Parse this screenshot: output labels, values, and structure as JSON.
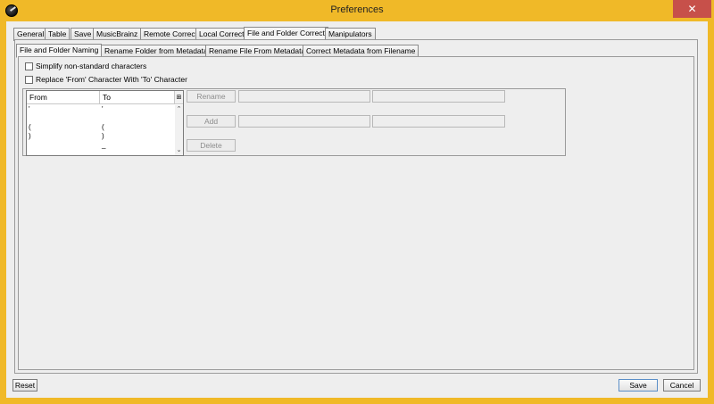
{
  "window": {
    "title": "Preferences",
    "close_glyph": "✕",
    "accent": "#f0b928",
    "close_color": "#c7504a"
  },
  "outer_tabs": [
    {
      "label": "General"
    },
    {
      "label": "Table"
    },
    {
      "label": "Save"
    },
    {
      "label": "MusicBrainz"
    },
    {
      "label": "Remote Correct"
    },
    {
      "label": "Local Correct"
    },
    {
      "label": "File and Folder Correct",
      "selected": true
    },
    {
      "label": "Manipulators"
    }
  ],
  "inner_tabs": [
    {
      "label": "File and Folder Naming",
      "selected": true
    },
    {
      "label": "Rename Folder from Metadata"
    },
    {
      "label": "Rename File From Metadata"
    },
    {
      "label": "Correct Metadata from Filename"
    }
  ],
  "options": {
    "simplify_label": "Simplify non-standard characters",
    "simplify_checked": false,
    "replace_label": "Replace 'From' Character With 'To' Character",
    "replace_checked": false
  },
  "char_table": {
    "headers": {
      "from": "From",
      "to": "To"
    },
    "column_menu_icon": "column-menu-icon",
    "rows": [
      {
        "from": "'",
        "to": "'"
      },
      {
        "from": "",
        "to": ""
      },
      {
        "from": "(",
        "to": "("
      },
      {
        "from": ")",
        "to": ")"
      },
      {
        "from": "",
        "to": "_"
      }
    ]
  },
  "actions": {
    "rename_label": "Rename",
    "add_label": "Add",
    "delete_label": "Delete"
  },
  "footer": {
    "reset_label": "Reset",
    "save_label": "Save",
    "cancel_label": "Cancel"
  }
}
